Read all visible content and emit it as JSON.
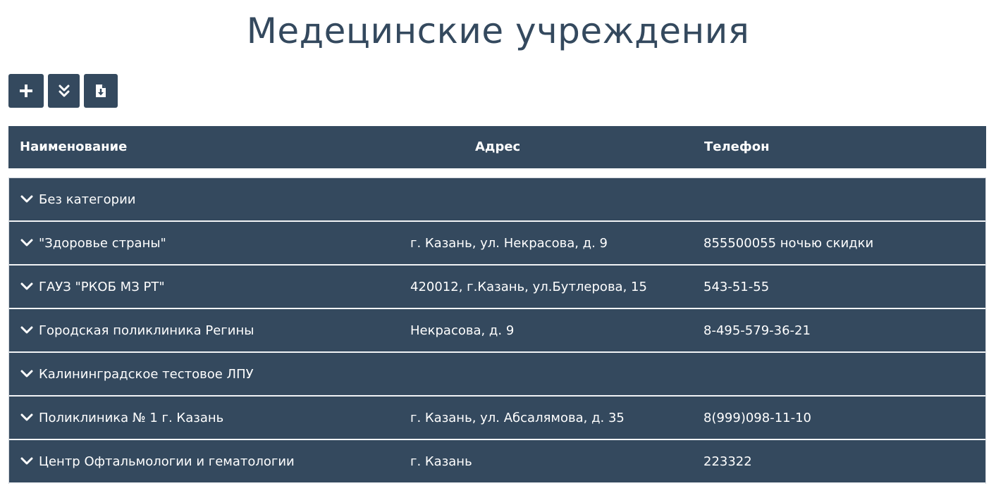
{
  "page": {
    "title": "Медецинские учреждения"
  },
  "toolbar": {
    "buttons": [
      {
        "icon": "plus-icon",
        "label": "+"
      },
      {
        "icon": "double-chevron-down-icon",
        "label": ""
      },
      {
        "icon": "file-download-icon",
        "label": ""
      }
    ]
  },
  "table": {
    "columns": [
      "Наименование",
      "Адрес",
      "Телефон"
    ],
    "rows": [
      {
        "name": "Без категории",
        "address": "",
        "phone": ""
      },
      {
        "name": "\"Здоровье страны\"",
        "address": "г. Казань, ул. Некрасова, д. 9",
        "phone": "855500055 ночью скидки"
      },
      {
        "name": "ГАУЗ \"РКОБ МЗ РТ\"",
        "address": "420012, г.Казань, ул.Бутлерова, 15",
        "phone": "543-51-55"
      },
      {
        "name": "Городская поликлиника Регины",
        "address": "Некрасова, д. 9",
        "phone": "8-495-579-36-21"
      },
      {
        "name": "Калининградское тестовое ЛПУ",
        "address": "",
        "phone": ""
      },
      {
        "name": "Поликлиника № 1 г. Казань",
        "address": "г. Казань, ул. Абсалямова, д. 35",
        "phone": "8(999)098-11-10"
      },
      {
        "name": "Центр Офтальмологии и гематологии",
        "address": "г. Казань",
        "phone": "223322"
      }
    ]
  },
  "colors": {
    "primary": "#34495e",
    "text_on_primary": "#ffffff",
    "background": "#ffffff"
  }
}
